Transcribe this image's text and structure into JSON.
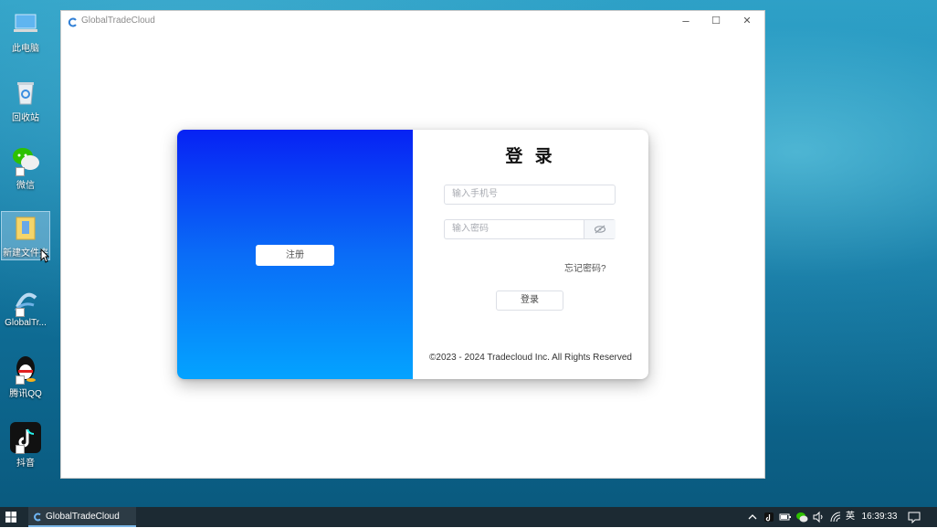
{
  "desktop": {
    "icons": [
      {
        "label": "此电脑",
        "icon": "computer-icon"
      },
      {
        "label": "回收站",
        "icon": "recycle-bin-icon"
      },
      {
        "label": "微信",
        "icon": "wechat-icon"
      },
      {
        "label": "新建文件夹",
        "icon": "folder-icon"
      },
      {
        "label": "GlobalTr...",
        "icon": "globaltrade-icon"
      },
      {
        "label": "腾讯QQ",
        "icon": "qq-icon"
      },
      {
        "label": "抖音",
        "icon": "douyin-icon"
      }
    ]
  },
  "window": {
    "title": "GlobalTradeCloud",
    "controls": {
      "minimize": "–",
      "maximize": "☐",
      "close": "✕"
    }
  },
  "login": {
    "register_label": "注册",
    "title": "登 录",
    "phone_placeholder": "输入手机号",
    "password_placeholder": "输入密码",
    "forgot_label": "忘记密码?",
    "login_label": "登录",
    "copyright": "©2023 - 2024 Tradecloud Inc. All Rights Reserved"
  },
  "taskbar": {
    "app_label": "GlobalTradeCloud",
    "ime": "英",
    "time": "16:39:33"
  },
  "colors": {
    "gradient_top": "#0722f4",
    "gradient_bottom": "#04a3ff",
    "taskbar": "#1c2a33"
  }
}
